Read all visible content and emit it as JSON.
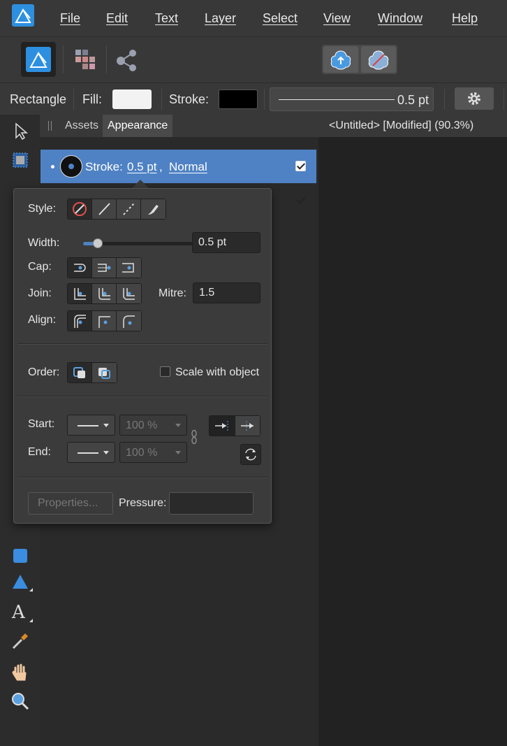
{
  "menu": {
    "items": [
      "File",
      "Edit",
      "Text",
      "Layer",
      "Select",
      "View",
      "Window",
      "Help"
    ]
  },
  "context": {
    "tool_name": "Rectangle",
    "fill_label": "Fill:",
    "stroke_label": "Stroke:",
    "stroke_width": "0.5 pt",
    "fill_color": "#f2f2f2",
    "stroke_color": "#000000"
  },
  "panel": {
    "tabs": [
      "Assets",
      "Appearance"
    ],
    "active_tab": "Appearance",
    "row": {
      "label": "Stroke:",
      "width": "0.5 pt",
      "separator": ",",
      "blend": "Normal"
    }
  },
  "document": {
    "title": "<Untitled> [Modified] (90.3%)"
  },
  "stroke_popover": {
    "style_label": "Style:",
    "width_label": "Width:",
    "width_value": "0.5 pt",
    "cap_label": "Cap:",
    "join_label": "Join:",
    "mitre_label": "Mitre:",
    "mitre_value": "1.5",
    "align_label": "Align:",
    "order_label": "Order:",
    "scale_label": "Scale with object",
    "start_label": "Start:",
    "end_label": "End:",
    "start_scale": "100 %",
    "end_scale": "100 %",
    "properties_label": "Properties...",
    "pressure_label": "Pressure:"
  }
}
